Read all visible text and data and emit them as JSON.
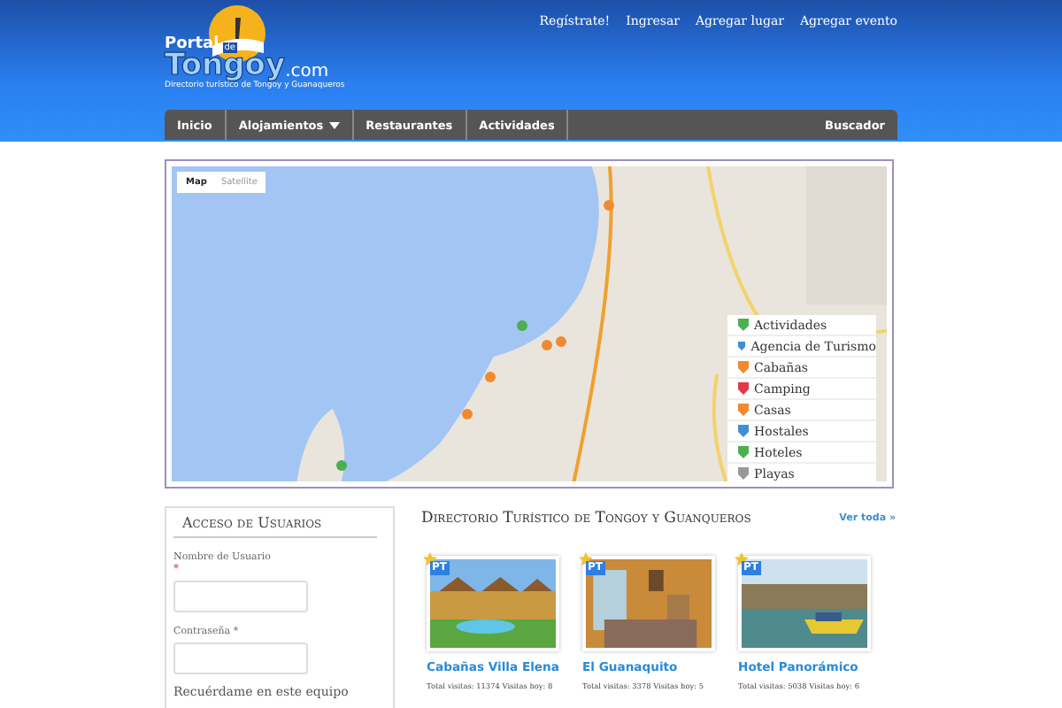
{
  "top_links": [
    "Regístrate!",
    "Ingresar",
    "Agregar lugar",
    "Agregar evento"
  ],
  "logo": {
    "portal": "Portal",
    "de": "de",
    "name": "Tongoy",
    ".com": ".com",
    "tagline": "Directorio turístico de Tongoy y Guanaqueros"
  },
  "nav": {
    "items": [
      {
        "label": "Inicio",
        "dropdown": false
      },
      {
        "label": "Alojamientos",
        "dropdown": true
      },
      {
        "label": "Restaurantes",
        "dropdown": false
      },
      {
        "label": "Actividades",
        "dropdown": false
      }
    ],
    "right": "Buscador"
  },
  "map": {
    "types": [
      {
        "label": "Map",
        "selected": true
      },
      {
        "label": "Satellite",
        "selected": false
      }
    ],
    "legend": [
      {
        "label": "Actividades",
        "color": "#4caf50"
      },
      {
        "label": "Agencia de Turismo",
        "color": "#3f8fd6"
      },
      {
        "label": "Cabañas",
        "color": "#f08a30"
      },
      {
        "label": "Camping",
        "color": "#e03a4a"
      },
      {
        "label": "Casas",
        "color": "#f08a30"
      },
      {
        "label": "Hostales",
        "color": "#3f8fd6"
      },
      {
        "label": "Hoteles",
        "color": "#4caf50"
      },
      {
        "label": "Playas",
        "color": "#999999"
      }
    ]
  },
  "login": {
    "title": "Acceso de Usuarios",
    "username_label": "Nombre de Usuario",
    "username_required": "*",
    "password_label": "Contraseña *",
    "remember": "Recuérdame en este equipo"
  },
  "directory": {
    "title": "Directorio Turístico de Tongoy y Guanqueros",
    "view_all": "Ver toda »",
    "cards": [
      {
        "badge": "PT",
        "name": "Cabañas Villa Elena",
        "stats": "Total visitas: 11374 Visitas hoy: 8"
      },
      {
        "badge": "PT",
        "name": "El Guanaquito",
        "stats": "Total visitas: 3378 Visitas hoy: 5"
      },
      {
        "badge": "PT",
        "name": "Hotel Panorámico",
        "stats": "Total visitas: 5038 Visitas hoy: 6"
      }
    ]
  }
}
